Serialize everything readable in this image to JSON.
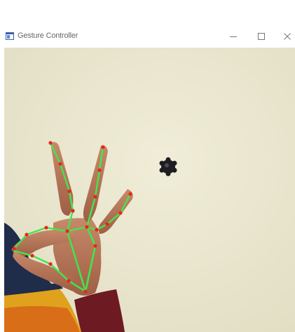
{
  "window": {
    "title": "Gesture Controller",
    "icon": "app-window-icon",
    "controls": {
      "minimize_icon": "minimize-icon",
      "maximize_icon": "maximize-icon",
      "close_icon": "close-icon"
    }
  },
  "video_feed": {
    "overlay": "hand-landmark-skeleton",
    "colors": {
      "wall": "#ebe8d2",
      "connections": "#3fe84a",
      "landmarks": "#e8261c"
    }
  }
}
